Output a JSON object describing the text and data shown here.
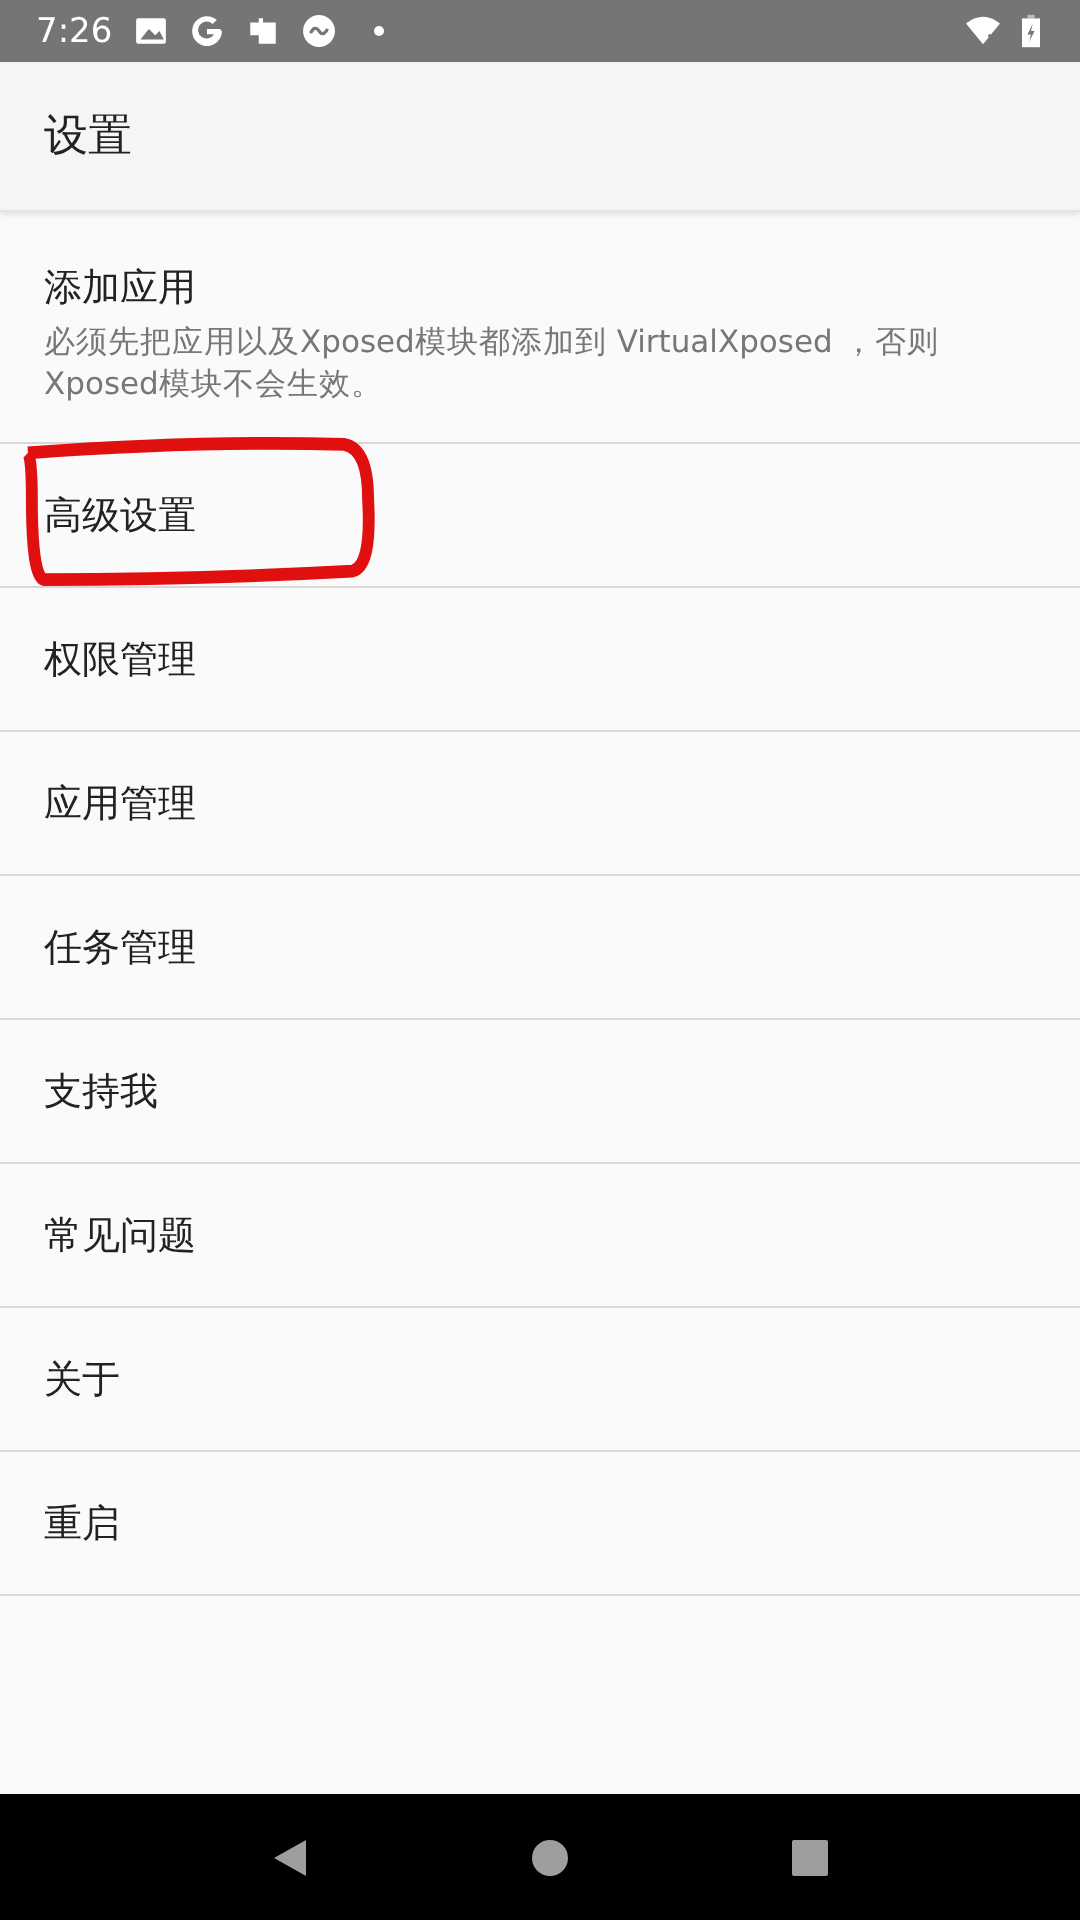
{
  "status_bar": {
    "time": "7:26"
  },
  "app_bar": {
    "title": "设置"
  },
  "items": [
    {
      "title": "添加应用",
      "summary": "必须先把应用以及Xposed模块都添加到 VirtualXposed ，否则Xposed模块不会生效。",
      "circled": false
    },
    {
      "title": "高级设置",
      "circled": true
    },
    {
      "title": "权限管理",
      "circled": false
    },
    {
      "title": "应用管理",
      "circled": false
    },
    {
      "title": "任务管理",
      "circled": false
    },
    {
      "title": "支持我",
      "circled": false
    },
    {
      "title": "常见问题",
      "circled": false
    },
    {
      "title": "关于",
      "circled": false
    },
    {
      "title": "重启",
      "circled": false
    }
  ]
}
